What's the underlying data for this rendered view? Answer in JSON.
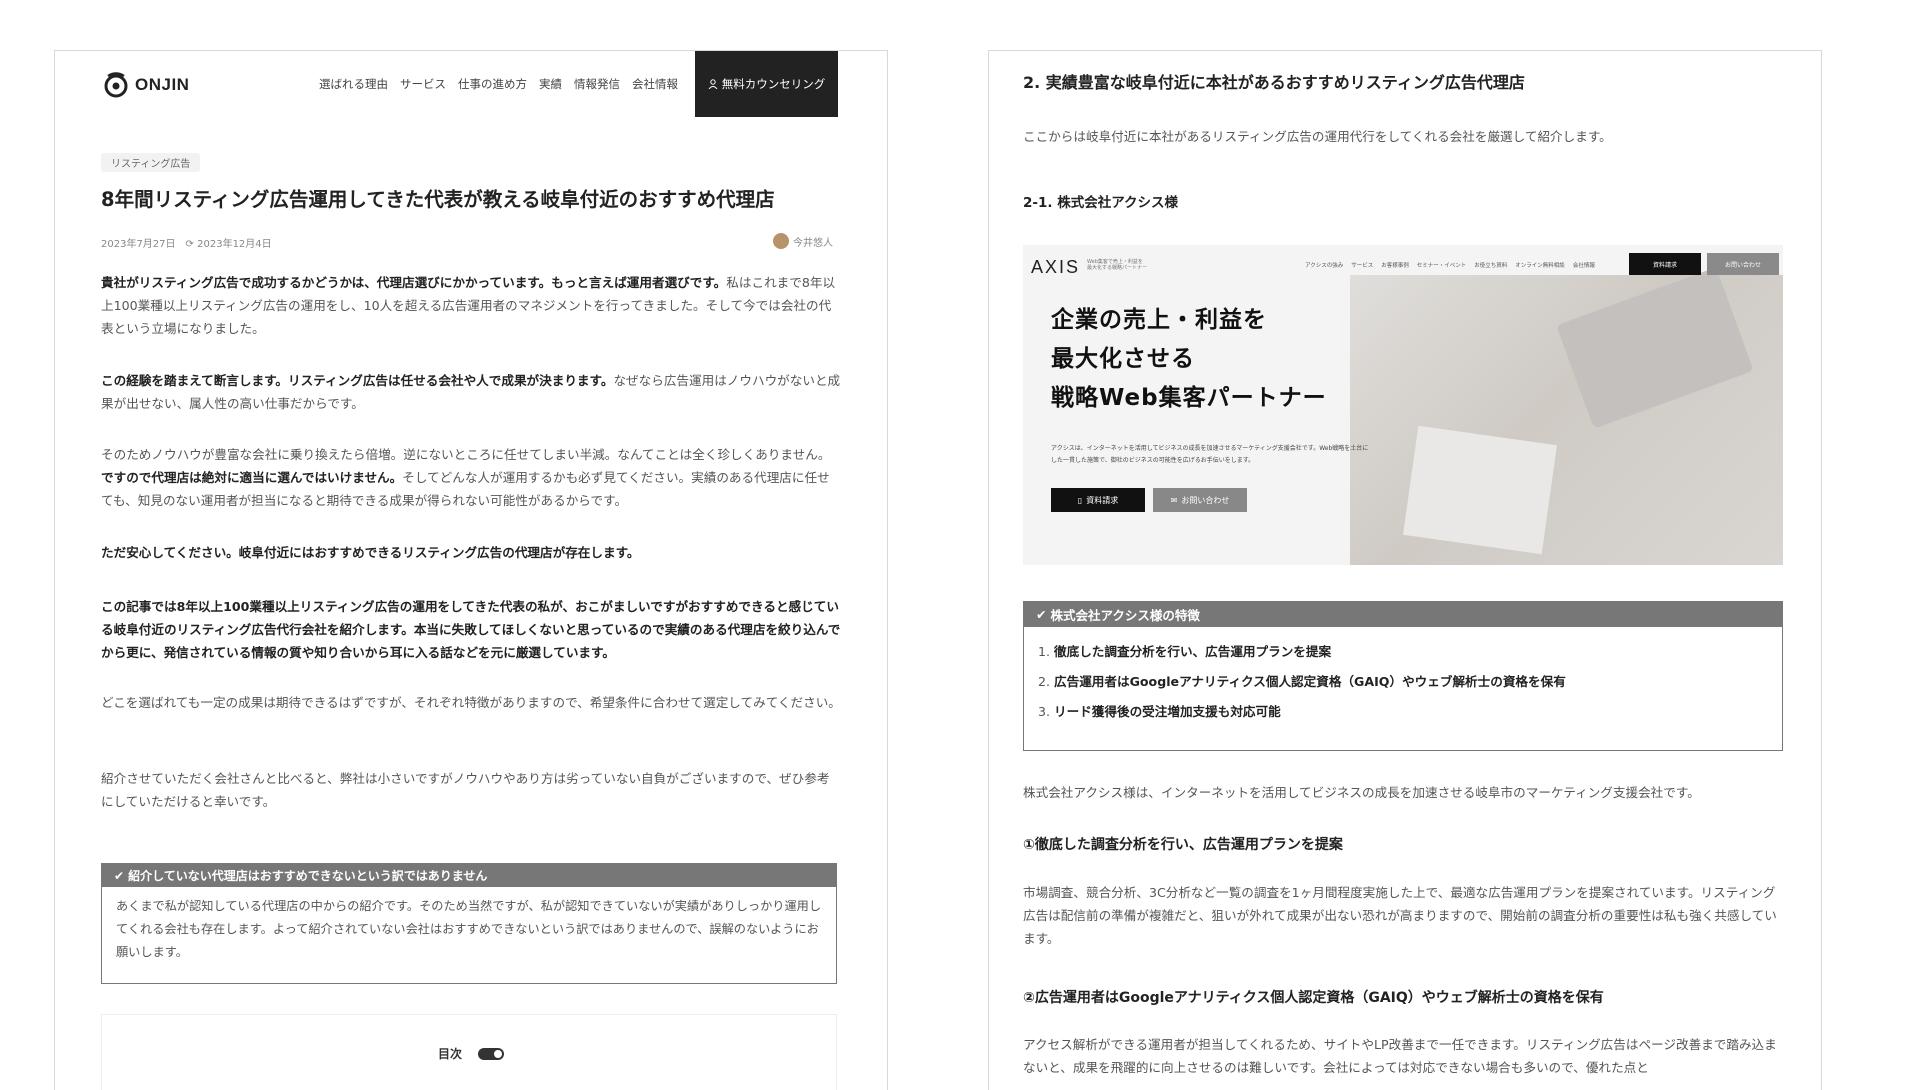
{
  "left": {
    "logo_text": "ONJIN",
    "nav": [
      "選ばれる理由",
      "サービス",
      "仕事の進め方",
      "実績",
      "情報発信",
      "会社情報"
    ],
    "cta_label": "無料カウンセリング",
    "tag": "リスティング広告",
    "title": "8年間リスティング広告運用してきた代表が教える岐阜付近のおすすめ代理店",
    "published": "2023年7月27日",
    "updated": "2023年12月4日",
    "author": "今井悠人",
    "paragraphs": [
      {
        "bold": "貴社がリスティング広告で成功するかどうかは、代理店選びにかかっています。もっと言えば運用者選びです。",
        "text": "私はこれまで8年以上100業種以上リスティング広告の運用をし、10人を超える広告運用者のマネジメントを行ってきました。そして今では会社の代表という立場になりました。"
      },
      {
        "bold": "この経験を踏まえて断言します。リスティング広告は任せる会社や人で成果が決まります。",
        "text": "なぜなら広告運用はノウハウがないと成果が出せない、属人性の高い仕事だからです。"
      },
      {
        "pre": "そのためノウハウが豊富な会社に乗り換えたら倍増。逆にないところに任せてしまい半減。なんてことは全く珍しくありません。",
        "bold": "ですので代理店は絶対に適当に選んではいけません。",
        "text": "そしてどんな人が運用するかも必ず見てください。実績のある代理店に任せても、知見のない運用者が担当になると期待できる成果が得られない可能性があるからです。"
      },
      {
        "bold": "ただ安心してください。岐阜付近にはおすすめできるリスティング広告の代理店が存在します。",
        "text": ""
      },
      {
        "bold": "この記事では8年以上100業種以上リスティング広告の運用をしてきた代表の私が、おこがましいですがおすすめできると感じている岐阜付近のリスティング広告代行会社を紹介します。本当に失敗してほしくないと思っているので実績のある代理店を絞り込んでから更に、発信されている情報の質や知り合いから耳に入る話などを元に厳選しています。",
        "text": ""
      },
      {
        "bold": "",
        "text": "どこを選ばれても一定の成果は期待できるはずですが、それぞれ特徴がありますので、希望条件に合わせて選定してみてください。"
      },
      {
        "bold": "",
        "text": "紹介させていただく会社さんと比べると、弊社は小さいですがノウハウやあり方は劣っていない自負がございますので、ぜひ参考にしていただけると幸いです。"
      }
    ],
    "note_title": "紹介していない代理店はおすすめできないという訳ではありません",
    "note_body": "あくまで私が認知している代理店の中からの紹介です。そのため当然ですが、私が認知できていないが実績がありしっかり運用してくれる会社も存在します。よって紹介されていない会社はおすすめできないという訳ではありませんので、誤解のないようにお願いします。",
    "toc_label": "目次"
  },
  "right": {
    "h2": "2. 実績豊富な岐阜付近に本社があるおすすめリスティング広告代理店",
    "intro": "ここからは岐阜付近に本社があるリスティング広告の運用代行をしてくれる会社を厳選して紹介します。",
    "h3": "2-1. 株式会社アクシス様",
    "screenshot": {
      "logo": "AXIS",
      "tiny_tag": "Web集客で売上・利益を最大化する戦略パートナー",
      "nav": [
        "アクシスの強み",
        "サービス",
        "お客様事例",
        "セミナー・イベント",
        "お役立ち資料",
        "オンライン無料相談",
        "会社情報"
      ],
      "btn_primary": "資料請求",
      "btn_secondary": "お問い合わせ",
      "hero_lines": [
        "企業の売上・利益を",
        "最大化させる",
        "戦略Web集客パートナー"
      ],
      "hero_sub": "アクシスは、インターネットを活用してビジネスの成長を加速させるマーケティング支援会社です。Web戦略を土台にした一貫した施策で、御社のビジネスの可能性を広げるお手伝いをします。",
      "hero_btn1": "資料請求",
      "hero_btn2": "お問い合わせ"
    },
    "features_title": "株式会社アクシス様の特徴",
    "features": [
      "徹底した調査分析を行い、広告運用プランを提案",
      "広告運用者はGoogleアナリティクス個人認定資格（GAIQ）やウェブ解析士の資格を保有",
      "リード獲得後の受注増加支援も対応可能"
    ],
    "company_desc": "株式会社アクシス様は、インターネットを活用してビジネスの成長を加速させる岐阜市のマーケティング支援会社です。",
    "sub1_title": "①徹底した調査分析を行い、広告運用プランを提案",
    "sub1_body": "市場調査、競合分析、3C分析など一覧の調査を1ヶ月間程度実施した上で、最適な広告運用プランを提案されています。リスティング広告は配信前の準備が複雑だと、狙いが外れて成果が出ない恐れが高まりますので、開始前の調査分析の重要性は私も強く共感しています。",
    "sub2_title": "②広告運用者はGoogleアナリティクス個人認定資格（GAIQ）やウェブ解析士の資格を保有",
    "sub2_body": "アクセス解析ができる運用者が担当してくれるため、サイトやLP改善まで一任できます。リスティング広告はページ改善まで踏み込まないと、成果を飛躍的に向上させるのは難しいです。会社によっては対応できない場合も多いので、優れた点と"
  }
}
